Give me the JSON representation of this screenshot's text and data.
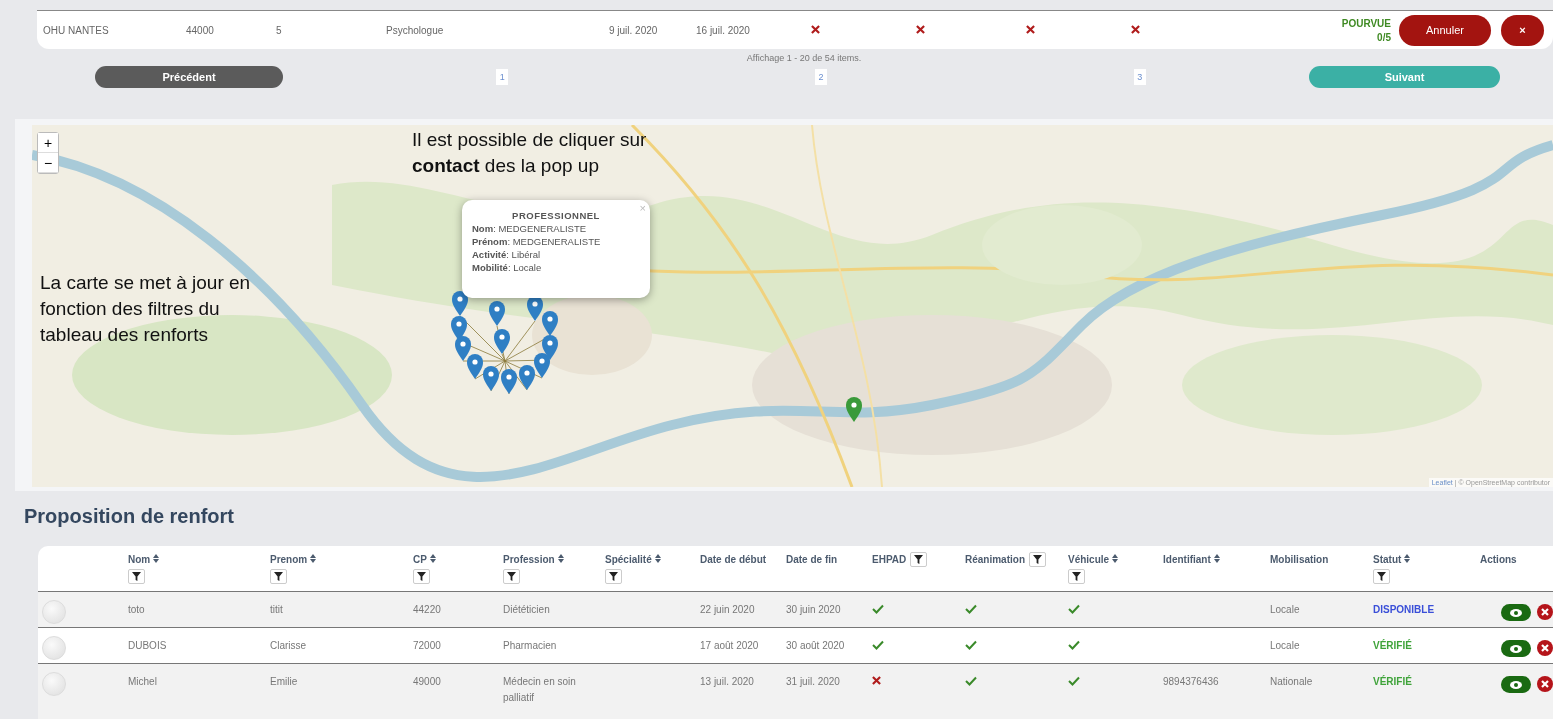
{
  "top_row": {
    "cells": [
      "OHU NANTES",
      "44000",
      "5",
      "Psychologue",
      "9 juil. 2020",
      "16 juil. 2020"
    ],
    "flags": [
      false,
      false,
      false,
      false
    ],
    "status": "POURVUE",
    "count": "0/5",
    "cancel_button": "Annuler",
    "close_button": "×"
  },
  "pagination": {
    "summary": "Affichage 1 - 20 de 54 items.",
    "previous": "Précédent",
    "next": "Suivant",
    "pages": [
      {
        "label": "1",
        "selected": false
      },
      {
        "label": "2",
        "selected": false
      },
      {
        "label": "3",
        "selected": false
      }
    ]
  },
  "map": {
    "zoom_in": "+",
    "zoom_out": "−",
    "annotations": [
      {
        "text": "Il est possible de cliquer sur\n**contact** des la pop up"
      },
      {
        "text": "La carte se met à jour en\nfonction des filtres du\ntableau des renforts"
      }
    ],
    "popup": {
      "close": "×",
      "title": "PROFESSIONNEL",
      "lines": [
        "**Nom**: MEDGENERALISTE",
        "**Prénom**: MEDGENERALISTE",
        "**Activité**: Libéral",
        "**Mobilité**: Locale"
      ]
    },
    "attribution": {
      "link": "Leaflet",
      "text": "| © OpenStreetMap contributor"
    }
  },
  "section_title": "Proposition de renfort",
  "table": {
    "columns": [
      {
        "label": "Nom",
        "kind": "stacked",
        "sortable": true,
        "filter": true
      },
      {
        "label": "Prenom",
        "kind": "stacked",
        "sortable": true,
        "filter": true
      },
      {
        "label": "CP",
        "kind": "stacked",
        "sortable": true,
        "filter": true
      },
      {
        "label": "Profession",
        "kind": "stacked",
        "sortable": true,
        "filter": true
      },
      {
        "label": "Spécialité",
        "kind": "stacked",
        "sortable": true,
        "filter": true
      },
      {
        "label": "Date de début",
        "kind": "stacked",
        "sortable": false,
        "filter": false
      },
      {
        "label": "Date de fin",
        "kind": "stacked",
        "sortable": false,
        "filter": false
      },
      {
        "label": "EHPAD",
        "kind": "inline",
        "sortable": false,
        "filter": true
      },
      {
        "label": "Réanimation",
        "kind": "inline",
        "sortable": false,
        "filter": true
      },
      {
        "label": "Véhicule",
        "kind": "stacked",
        "sortable": true,
        "filter": true
      },
      {
        "label": "Identifiant",
        "kind": "stacked",
        "sortable": true,
        "filter": false
      },
      {
        "label": "Mobilisation",
        "kind": "stacked",
        "sortable": false,
        "filter": false
      },
      {
        "label": "Statut",
        "kind": "stacked",
        "sortable": true,
        "filter": true
      },
      {
        "label": "Actions",
        "kind": "stacked",
        "sortable": false,
        "filter": false
      }
    ],
    "rows": [
      {
        "selected": false,
        "nom": "toto",
        "prenom": "titit",
        "cp": "44220",
        "profession": "Diététicien",
        "debut": "22 juin 2020",
        "fin": "30 juin 2020",
        "ehpad": true,
        "reanimation": true,
        "vehicule": true,
        "mobilisation": "Locale",
        "statut": "DISPONIBLE",
        "color": "#3a4fd8"
      },
      {
        "selected": false,
        "nom": "DUBOIS",
        "prenom": "Clarisse",
        "cp": "72000",
        "profession": "Pharmacien",
        "debut": "17 août 2020",
        "fin": "30 août 2020",
        "ehpad": true,
        "reanimation": true,
        "vehicule": true,
        "mobilisation": "Locale",
        "statut": "VÉRIFIÉ",
        "color": "#3fa33a"
      },
      {
        "selected": false,
        "nom": "Michel",
        "prenom": "Emilie",
        "cp": "49000",
        "profession": "Médecin en soin palliatif",
        "debut": "13 juil. 2020",
        "fin": "31 juil. 2020",
        "ehpad": false,
        "reanimation": true,
        "vehicule": true,
        "identifiant": "9894376436",
        "mobilisation": "Nationale",
        "statut": "VÉRIFIÉ",
        "color": "#3fa33a"
      }
    ]
  }
}
